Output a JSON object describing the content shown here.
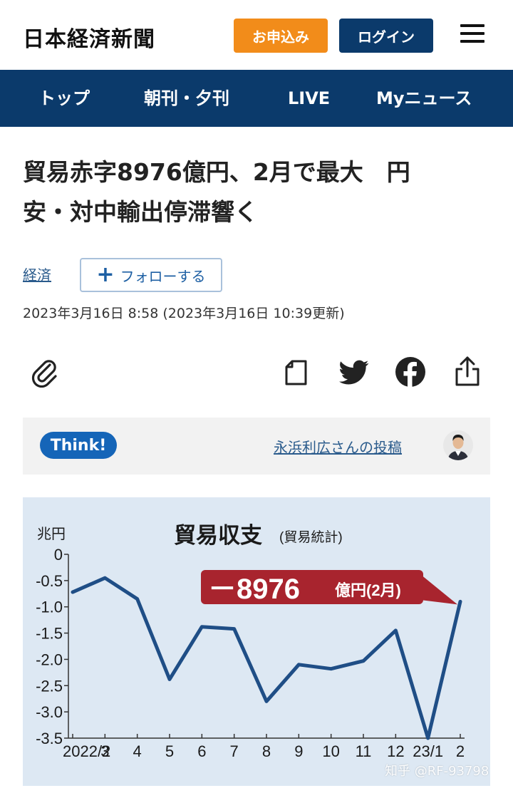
{
  "header": {
    "logo": "日本経済新聞",
    "apply_label": "お申込み",
    "login_label": "ログイン"
  },
  "nav": {
    "items": [
      "トップ",
      "朝刊・夕刊",
      "LIVE",
      "Myニュース"
    ]
  },
  "article": {
    "headline_line1": "貿易赤字8976億円、2月で最大　円",
    "headline_line2": "安・対中輸出停滞響く",
    "topic": "経済",
    "follow_label": "フォローする",
    "date": "2023年3月16日 8:58 (2023年3月16日 10:39更新)"
  },
  "think": {
    "badge": "Think!",
    "link": "永浜利広さんの投稿"
  },
  "colors": {
    "brand_navy": "#0b3a6b",
    "apply_orange": "#f28c1a",
    "think_blue": "#1565b8",
    "chart_line": "#1f4e86",
    "callout_red": "#a8242e"
  },
  "chart_data": {
    "type": "line",
    "title": "貿易収支",
    "subtitle": "(貿易統計)",
    "ylabel": "兆円",
    "ylim": [
      -3.5,
      0
    ],
    "yticks": [
      "0",
      "-0.5",
      "-1.0",
      "-1.5",
      "-2.0",
      "-2.5",
      "-3.0",
      "-3.5"
    ],
    "categories": [
      "2022/2",
      "3",
      "4",
      "5",
      "6",
      "7",
      "8",
      "9",
      "10",
      "11",
      "12",
      "23/1",
      "2"
    ],
    "values": [
      -0.72,
      -0.45,
      -0.85,
      -2.38,
      -1.38,
      -1.42,
      -2.8,
      -2.1,
      -2.18,
      -2.03,
      -1.45,
      -3.5,
      -0.9
    ],
    "annotation": {
      "value_text": "－8976",
      "unit_text": "億円(2月)"
    }
  },
  "watermark": "知乎 @RF-93798"
}
